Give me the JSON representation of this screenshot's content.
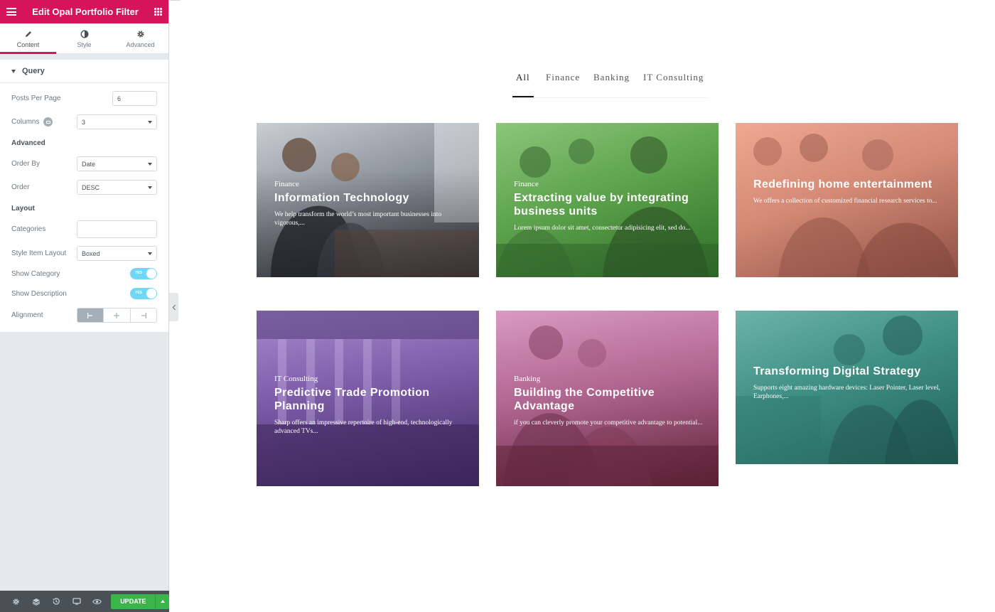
{
  "panel": {
    "title": "Edit Opal Portfolio Filter",
    "tabs": [
      {
        "label": "Content",
        "icon": "pencil-icon"
      },
      {
        "label": "Style",
        "icon": "half-circle-icon"
      },
      {
        "label": "Advanced",
        "icon": "gear-icon"
      }
    ],
    "section": "Query",
    "controls": {
      "posts_per_page": {
        "label": "Posts Per Page",
        "value": "6"
      },
      "columns": {
        "label": "Columns",
        "value": "3"
      },
      "advanced_heading": "Advanced",
      "order_by": {
        "label": "Order By",
        "value": "Date"
      },
      "order": {
        "label": "Order",
        "value": "DESC"
      },
      "layout_heading": "Layout",
      "categories": {
        "label": "Categories",
        "value": ""
      },
      "style_item_layout": {
        "label": "Style Item Layout",
        "value": "Boxed"
      },
      "show_category": {
        "label": "Show Category",
        "state": "YES"
      },
      "show_description": {
        "label": "Show Description",
        "state": "YES"
      },
      "alignment": {
        "label": "Alignment",
        "options": [
          "left",
          "center",
          "right"
        ],
        "selected": "left"
      }
    },
    "footer": {
      "icons": [
        "settings-icon",
        "layers-icon",
        "history-icon",
        "responsive-icon",
        "preview-icon"
      ],
      "update_label": "UPDATE"
    }
  },
  "preview": {
    "filters": [
      "All",
      "Finance",
      "Banking",
      "IT Consulting"
    ],
    "active_filter": "All",
    "cards": [
      {
        "category": "Finance",
        "title": "Information Technology",
        "description": "We help transform the world’s most important businesses into vigorous,...",
        "tint": "#3b3f45"
      },
      {
        "category": "Finance",
        "title": "Extracting value by integrating business units",
        "description": "Lorem ipsum dolor sit amet, consectetur adipisicing elit, sed do...",
        "tint": "#3f8b35"
      },
      {
        "category": "",
        "title": "Redefining home entertainment",
        "description": "We offers a collection of customized financial research services to...",
        "tint": "#c07a6a"
      },
      {
        "category": "IT Consulting",
        "title": "Predictive Trade Promotion Planning",
        "description": "Sharp offers an impressive repertoire of high-end, technologically advanced TVs...",
        "tint": "#5e3d82"
      },
      {
        "category": "Banking",
        "title": "Building the Competitive Advantage",
        "description": "if you can cleverly promote your competitive advantage to potential...",
        "tint": "#8a3b55"
      },
      {
        "category": "",
        "title": "Transforming Digital Strategy",
        "description": "Supports eight amazing hardware devices: Laser Pointer, Laser level, Earphones,...",
        "tint": "#2f7f74"
      }
    ]
  }
}
